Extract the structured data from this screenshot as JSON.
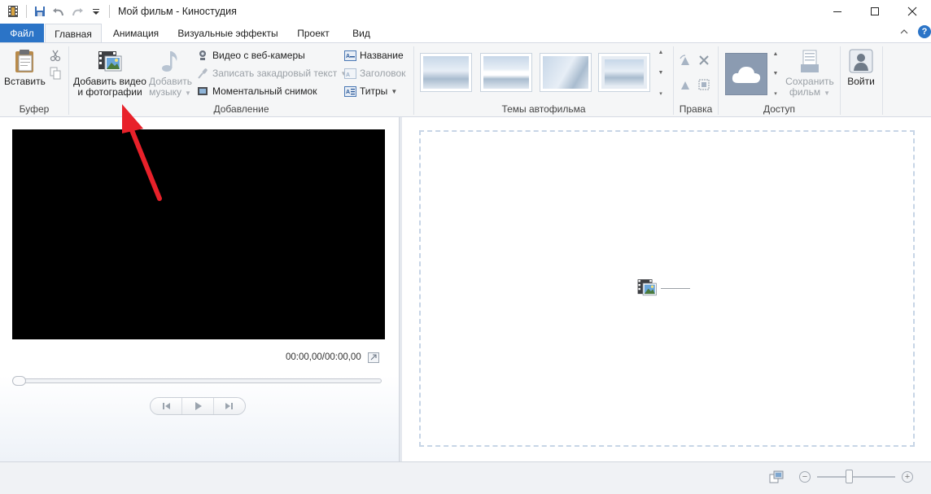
{
  "window": {
    "title": "Мой фильм - Киностудия"
  },
  "tabs": {
    "file": "Файл",
    "items": [
      "Главная",
      "Анимация",
      "Визуальные эффекты",
      "Проект",
      "Вид"
    ]
  },
  "ribbon": {
    "clipboard": {
      "label": "Буфер",
      "paste": "Вставить"
    },
    "add": {
      "label": "Добавление",
      "add_video_line1": "Добавить видео",
      "add_video_line2": "и фотографии",
      "add_music_line1": "Добавить",
      "add_music_line2": "музыку",
      "webcam": "Видео с веб-камеры",
      "narration": "Записать закадровый текст",
      "snapshot": "Моментальный снимок",
      "title": "Название",
      "caption": "Заголовок",
      "credits": "Титры"
    },
    "themes": {
      "label": "Темы автофильма"
    },
    "edit": {
      "label": "Правка"
    },
    "share": {
      "label": "Доступ",
      "save_line1": "Сохранить",
      "save_line2": "фильм"
    },
    "signin": {
      "label": "Войти"
    }
  },
  "player": {
    "timecode": "00:00,00/00:00,00",
    "seek_position": 0
  },
  "zoom": {
    "level": 0.4
  },
  "colors": {
    "file_tab": "#2b74c7",
    "arrow": "#e8212a",
    "help": "#2b74c7"
  }
}
